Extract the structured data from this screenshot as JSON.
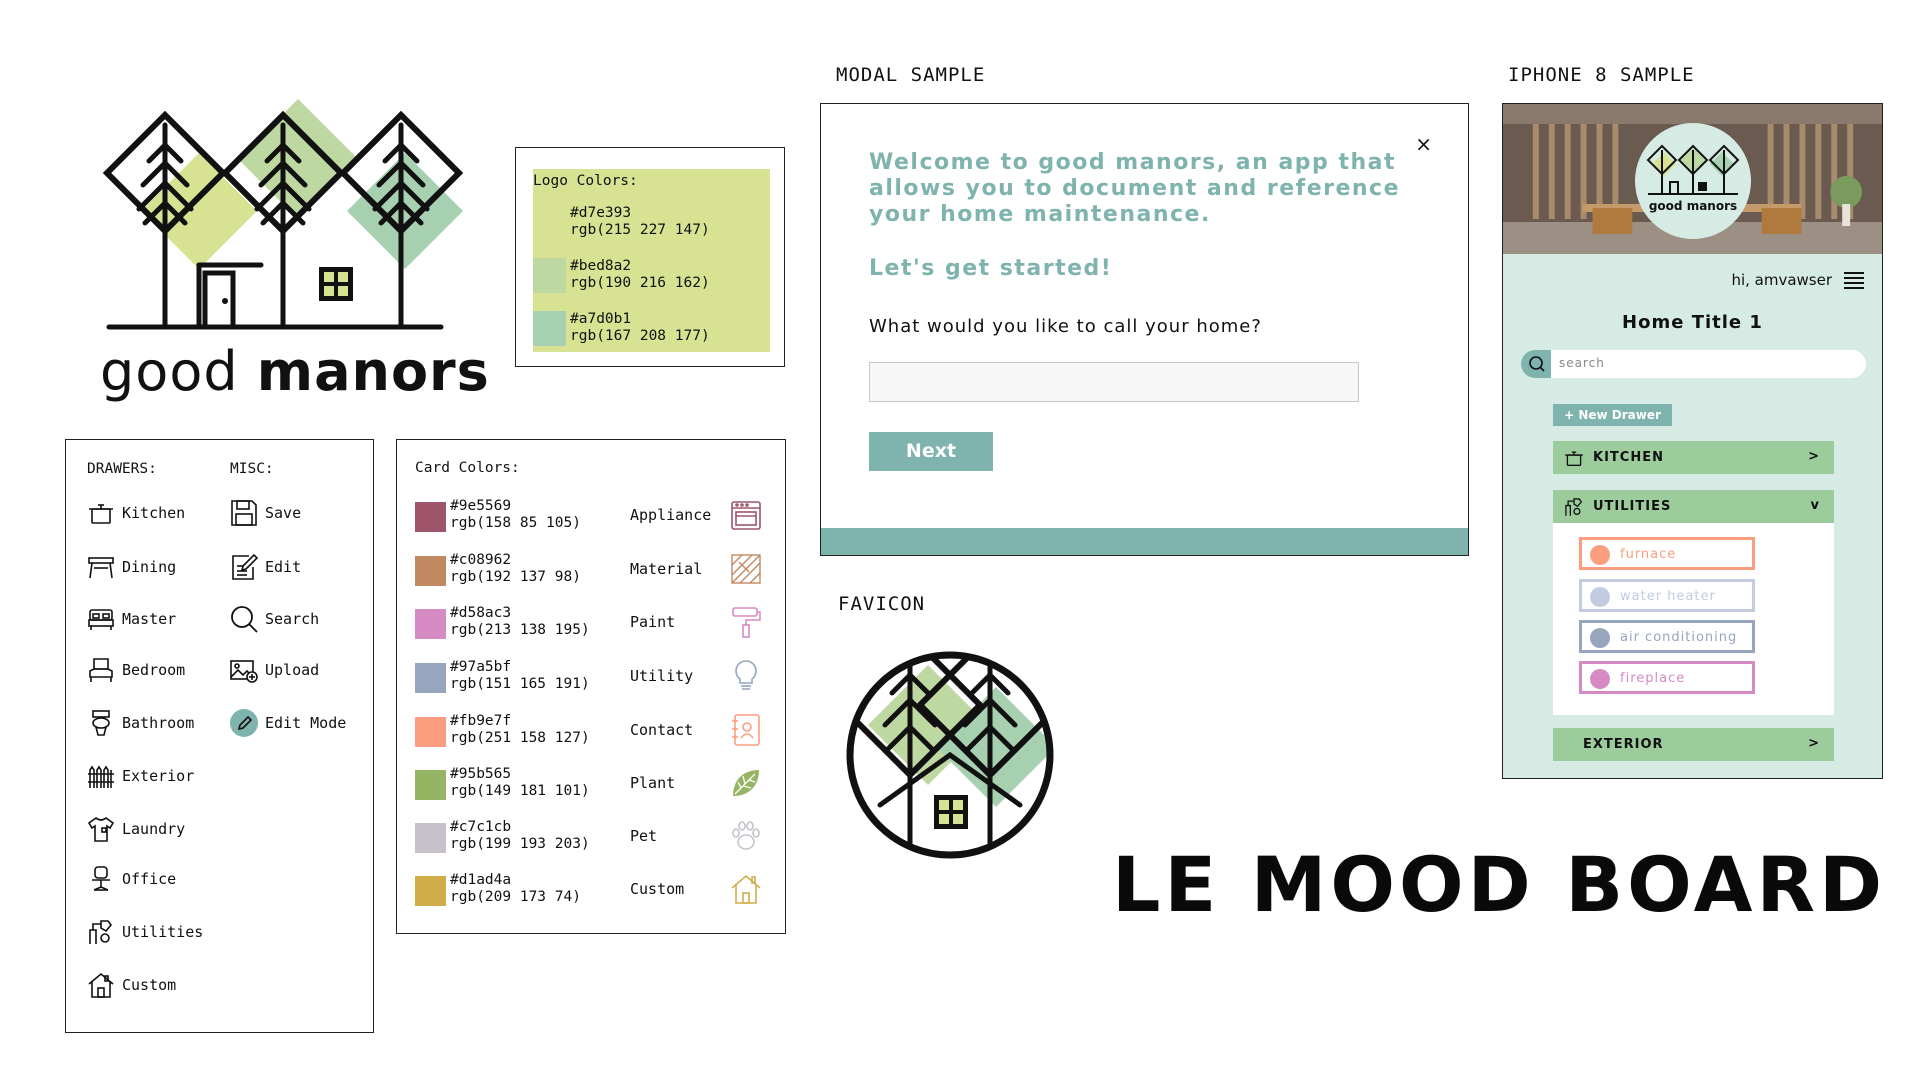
{
  "brand": {
    "word_light": "good ",
    "word_bold": "manors"
  },
  "logo_colors": {
    "title": "Logo Colors:",
    "items": [
      {
        "hex": "#d7e393",
        "rgb": "rgb(215 227 147)",
        "color": "#d7e393"
      },
      {
        "hex": "#bed8a2",
        "rgb": "rgb(190 216 162)",
        "color": "#bed8a2"
      },
      {
        "hex": "#a7d0b1",
        "rgb": "rgb(167 208 177)",
        "color": "#a7d0b1"
      }
    ]
  },
  "drawers": {
    "title": "DRAWERS:",
    "items": [
      "Kitchen",
      "Dining",
      "Master",
      "Bedroom",
      "Bathroom",
      "Exterior",
      "Laundry",
      "Office",
      "Utilities",
      "Custom"
    ]
  },
  "misc": {
    "title": "MISC:",
    "items": [
      "Save",
      "Edit",
      "Search",
      "Upload",
      "Edit Mode"
    ]
  },
  "card_colors": {
    "title": "Card Colors:",
    "items": [
      {
        "hex": "#9e5569",
        "rgb": "rgb(158 85 105)",
        "label": "Appliance",
        "icon": "stove-icon",
        "color": "#9e5569"
      },
      {
        "hex": "#c08962",
        "rgb": "rgb(192 137 98)",
        "label": "Material",
        "icon": "hatch-material-icon",
        "color": "#c08962"
      },
      {
        "hex": "#d58ac3",
        "rgb": "rgb(213 138 195)",
        "label": "Paint",
        "icon": "paint-roller-icon",
        "color": "#d58ac3"
      },
      {
        "hex": "#97a5bf",
        "rgb": "rgb(151 165 191)",
        "label": "Utility",
        "icon": "lightbulb-icon",
        "color": "#97a5bf"
      },
      {
        "hex": "#fb9e7f",
        "rgb": "rgb(251 158 127)",
        "label": "Contact",
        "icon": "address-book-icon",
        "color": "#fb9e7f"
      },
      {
        "hex": "#95b565",
        "rgb": "rgb(149 181 101)",
        "label": "Plant",
        "icon": "leaf-icon",
        "color": "#95b565"
      },
      {
        "hex": "#c7c1cb",
        "rgb": "rgb(199 193 203)",
        "label": "Pet",
        "icon": "paw-icon",
        "color": "#c7c1cb"
      },
      {
        "hex": "#d1ad4a",
        "rgb": "rgb(209 173 74)",
        "label": "Custom",
        "icon": "house-icon",
        "color": "#d1ad4a"
      }
    ]
  },
  "sections": {
    "modal": "MODAL SAMPLE",
    "iphone": "IPHONE 8 SAMPLE",
    "favicon": "FAVICON"
  },
  "modal": {
    "close": "×",
    "welcome": "Welcome to good manors, an app that allows you to document and reference your home maintenance.",
    "started": "Let's get started!",
    "question": "What would you like to call your home?",
    "input_value": "",
    "next": "Next",
    "accent": "#7fb3ae"
  },
  "mood_board": "LE MOOD BOARD",
  "phone": {
    "brand": "good manors",
    "greeting": "hi, amvawser",
    "home_title": "Home Title 1",
    "search_placeholder": "search",
    "new_drawer": "+ New Drawer",
    "drawers": [
      {
        "label": "KITCHEN",
        "chevron": ">"
      },
      {
        "label": "UTILITIES",
        "chevron": "v"
      },
      {
        "label": "EXTERIOR",
        "chevron": ">"
      }
    ],
    "utility_items": [
      {
        "label": "furnace",
        "color": "#fb9e7f"
      },
      {
        "label": "water heater",
        "color": "#c2cbe0"
      },
      {
        "label": "air conditioning",
        "color": "#97a5bf"
      },
      {
        "label": "fireplace",
        "color": "#d58ac3"
      }
    ]
  }
}
